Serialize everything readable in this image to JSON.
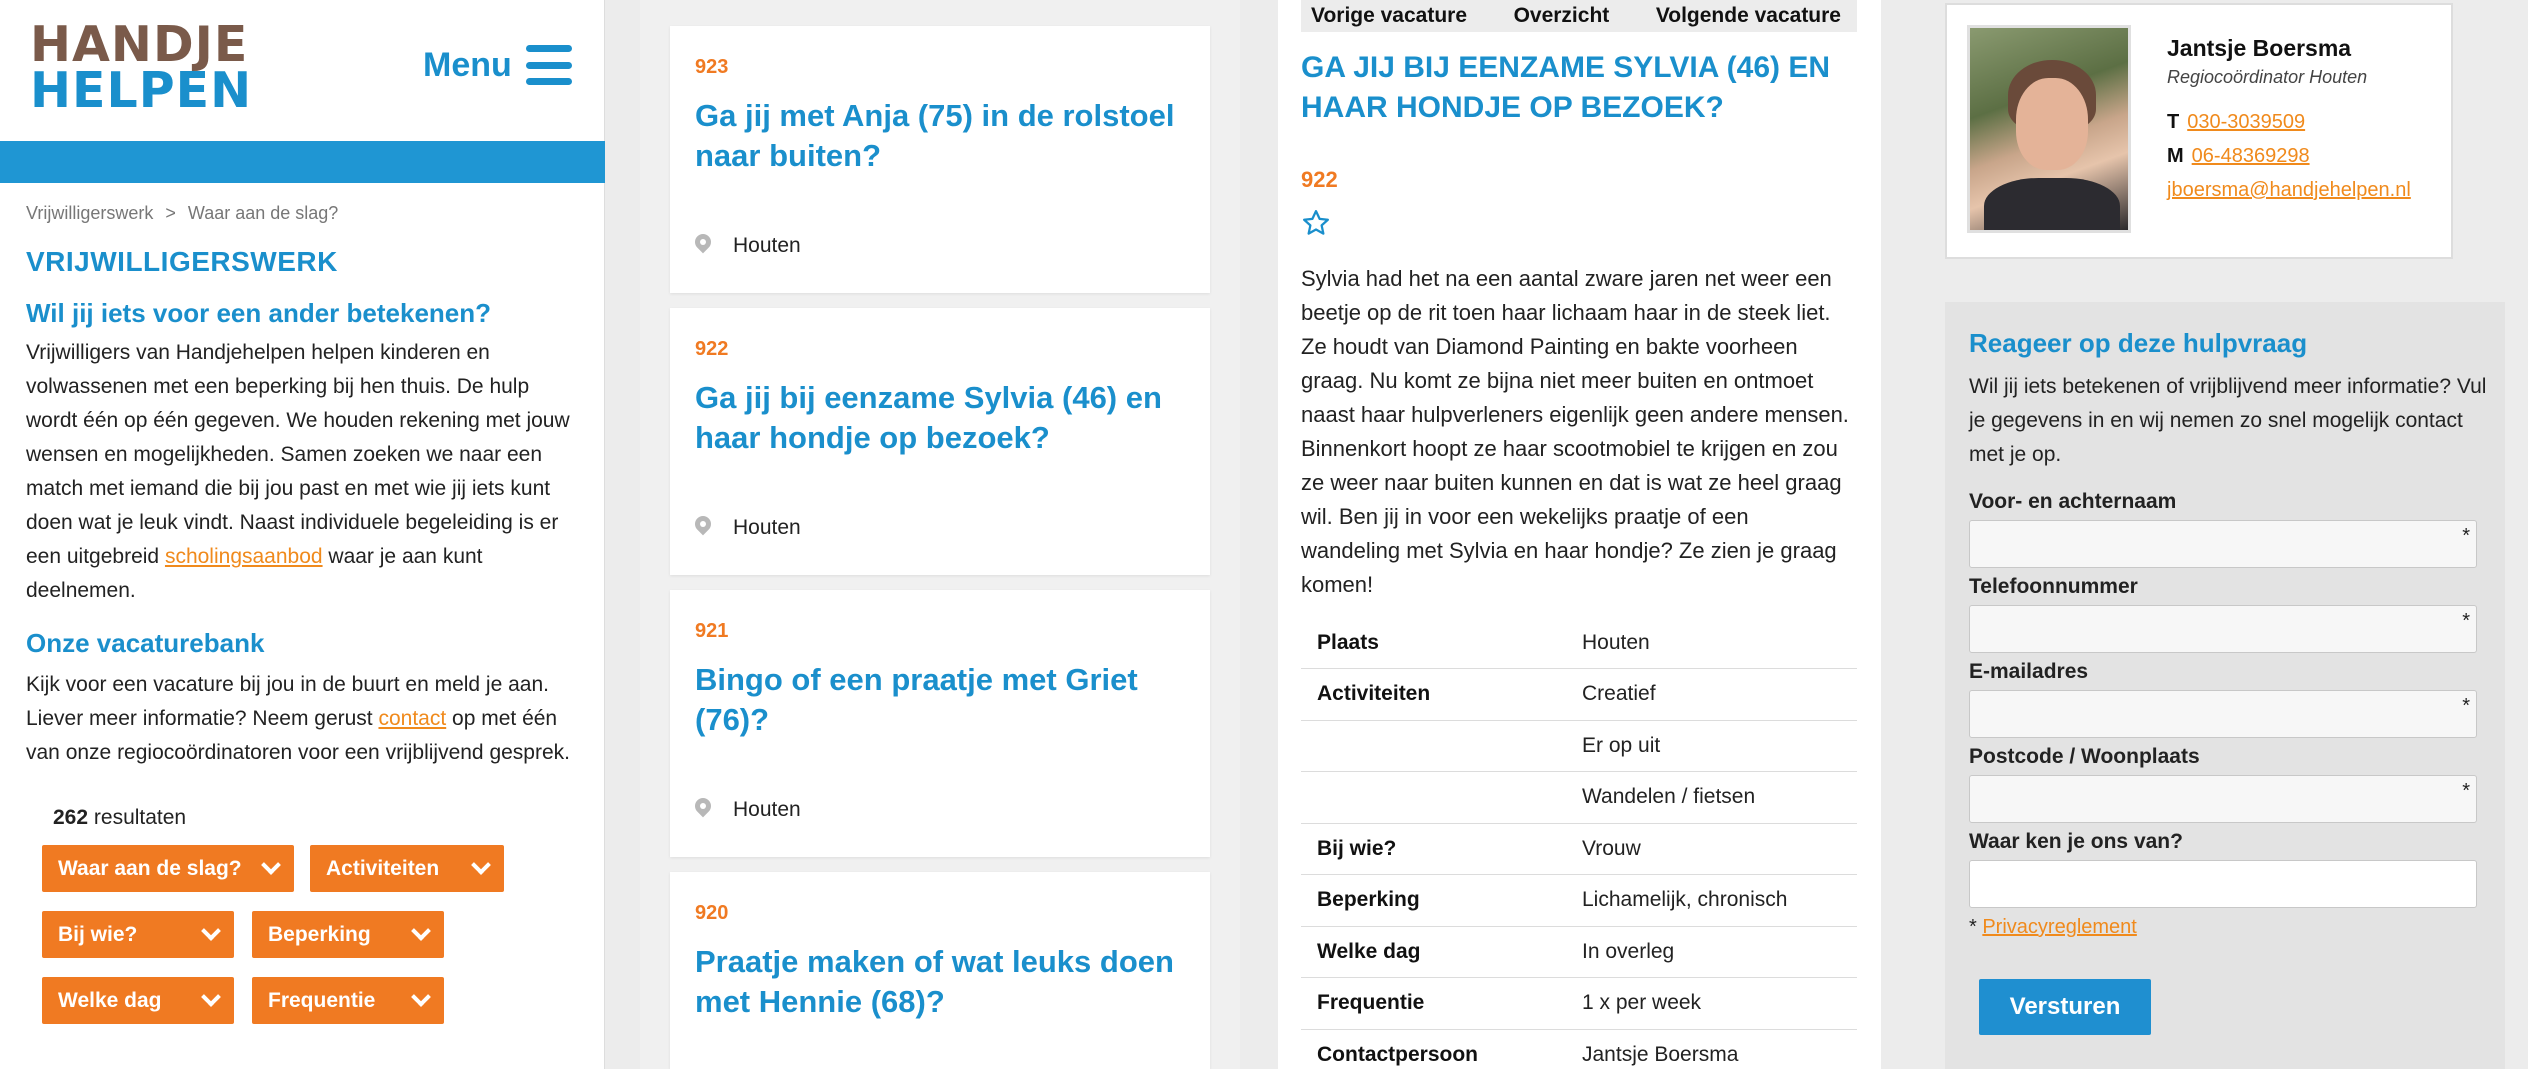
{
  "logo": {
    "line1": "HANDJE",
    "line2": "HELPEN"
  },
  "menu": {
    "label": "Menu"
  },
  "breadcrumb": {
    "items": [
      "Vrijwilligerswerk",
      "Waar aan de slag?"
    ],
    "separator": ">"
  },
  "intro": {
    "title": "VRIJWILLIGERSWERK",
    "subtitle": "Wil jij iets voor een ander betekenen?",
    "para1_before_link": "Vrijwilligers van Handjehelpen helpen kinderen en volwassenen met een beperking bij hen thuis. De hulp wordt één op één gegeven. We houden rekening met jouw wensen en mogelijkheden. Samen zoeken we naar een match met iemand die bij jou past en met wie jij iets kunt doen wat je leuk vindt. Naast individuele begeleiding is er een uitgebreid ",
    "para1_link": "scholingsaanbod",
    "para1_after_link": " waar je aan kunt deelnemen.",
    "bank_title": "Onze vacaturebank",
    "para2_before_link": "Kijk voor een vacature bij jou in de buurt en meld je aan. Liever meer informatie? Neem gerust ",
    "para2_link": "contact",
    "para2_after_link": " op met één van onze regiocoördinatoren voor een vrijblijvend gesprek."
  },
  "results": {
    "count": "262",
    "label": "resultaten"
  },
  "filters": [
    "Waar aan de slag?",
    "Activiteiten",
    "Bij wie?",
    "Beperking",
    "Welke dag",
    "Frequentie"
  ],
  "jobs": [
    {
      "number": "923",
      "title": "Ga jij met Anja (75) in de rolstoel naar buiten?",
      "location": "Houten"
    },
    {
      "number": "922",
      "title": "Ga jij bij eenzame Sylvia (46) en haar hondje op bezoek?",
      "location": "Houten"
    },
    {
      "number": "921",
      "title": "Bingo of een praatje met Griet (76)?",
      "location": "Houten"
    },
    {
      "number": "920",
      "title": "Praatje maken of wat leuks doen met Hennie (68)?",
      "location": "Houten"
    }
  ],
  "detail": {
    "nav": {
      "prev": "Vorige vacature",
      "overview": "Overzicht",
      "next": "Volgende vacature"
    },
    "title": "GA JIJ BIJ EENZAME SYLVIA (46) EN HAAR HONDJE OP BEZOEK?",
    "number": "922",
    "description": "Sylvia had het na een aantal zware jaren net weer een beetje op de rit toen haar lichaam haar in de steek liet. Ze houdt van Diamond Painting en bakte voorheen graag. Nu komt ze bijna niet meer buiten en ontmoet naast haar hulpverleners eigenlijk geen andere mensen. Binnenkort hoopt ze haar scootmobiel te krijgen en zou ze weer naar buiten kunnen en dat is wat ze heel graag wil. Ben jij in voor een wekelijks praatje of een wandeling met Sylvia en haar hondje? Ze zien je graag komen!",
    "specs": [
      {
        "key": "Plaats",
        "value": "Houten"
      },
      {
        "key": "Activiteiten",
        "value": "Creatief"
      },
      {
        "key": "",
        "value": "Er op uit"
      },
      {
        "key": "",
        "value": "Wandelen / fietsen"
      },
      {
        "key": "Bij wie?",
        "value": "Vrouw"
      },
      {
        "key": "Beperking",
        "value": "Lichamelijk, chronisch"
      },
      {
        "key": "Welke dag",
        "value": "In overleg"
      },
      {
        "key": "Frequentie",
        "value": "1 x per week"
      },
      {
        "key": "Contactpersoon",
        "value": "Jantsje Boersma"
      }
    ]
  },
  "contact": {
    "name": "Jantsje Boersma",
    "role": "Regiocoördinator Houten",
    "phone_label": "T",
    "phone": "030-3039509",
    "mobile_label": "M",
    "mobile": "06-48369298",
    "email": "jboersma@handjehelpen.nl"
  },
  "form": {
    "title": "Reageer op deze hulpvraag",
    "intro": "Wil jij iets betekenen of vrijblijvend meer informatie? Vul je gegevens in en wij nemen zo snel mogelijk contact met je op.",
    "fields": [
      {
        "label": "Voor- en achternaam",
        "required": "*"
      },
      {
        "label": "Telefoonnummer",
        "required": "*"
      },
      {
        "label": "E-mailadres",
        "required": "*"
      },
      {
        "label": "Postcode / Woonplaats",
        "required": "*"
      },
      {
        "label": "Waar ken je ons van?",
        "required": ""
      }
    ],
    "privacy_prefix": "* ",
    "privacy_link": "Privacyreglement",
    "submit": "Versturen"
  },
  "colors": {
    "brand_blue": "#1a8fcc",
    "accent_orange": "#f07a22",
    "link_orange": "#f08a1c"
  },
  "icons": {
    "menu": "hamburger-icon",
    "filter_chevron": "chevron-down-icon",
    "location": "map-pin-icon",
    "favorite": "star-outline-icon"
  }
}
